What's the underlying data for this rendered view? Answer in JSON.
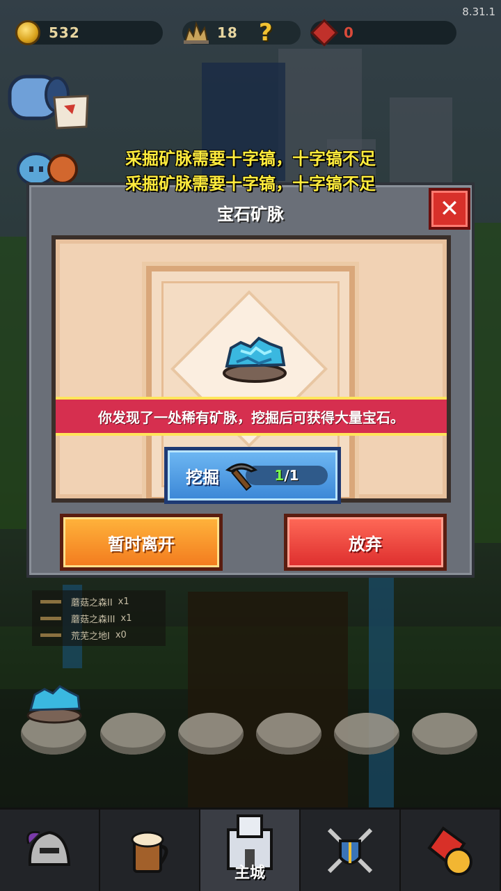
{
  "version": "8.31.1",
  "top_bar": {
    "gold": "532",
    "crystal": "18",
    "help_symbol": "?",
    "gems": "0"
  },
  "warnings": [
    "采掘矿脉需要十字镐，十字镐不足",
    "采掘矿脉需要十字镐，十字镐不足"
  ],
  "dialog": {
    "title": "宝石矿脉",
    "close_symbol": "✕",
    "description": "你发现了一处稀有矿脉，挖掘后可获得大量宝石。",
    "dig_button": {
      "label": "挖掘",
      "owned": "1",
      "required": "/1"
    },
    "leave_button": "暂时离开",
    "abandon_button": "放弃"
  },
  "mine_list": [
    {
      "name": "蘑菇之森II",
      "count": "x1"
    },
    {
      "name": "蘑菇之森III",
      "count": "x1"
    },
    {
      "name": "荒芜之地I",
      "count": "x0"
    }
  ],
  "nav": {
    "items": [
      {
        "icon": "helmet-icon",
        "label": ""
      },
      {
        "icon": "tavern-icon",
        "label": ""
      },
      {
        "icon": "castle-icon",
        "label": "主城"
      },
      {
        "icon": "battle-icon",
        "label": ""
      },
      {
        "icon": "shop-icon",
        "label": ""
      }
    ]
  },
  "colors": {
    "warning_text": "#ffec3d",
    "description_bar": "#d62f4f",
    "dig_button": "#3a86d6",
    "leave_button": "#f27a1e",
    "abandon_button": "#dd2d2d",
    "owned_count": "#7cff4a"
  }
}
